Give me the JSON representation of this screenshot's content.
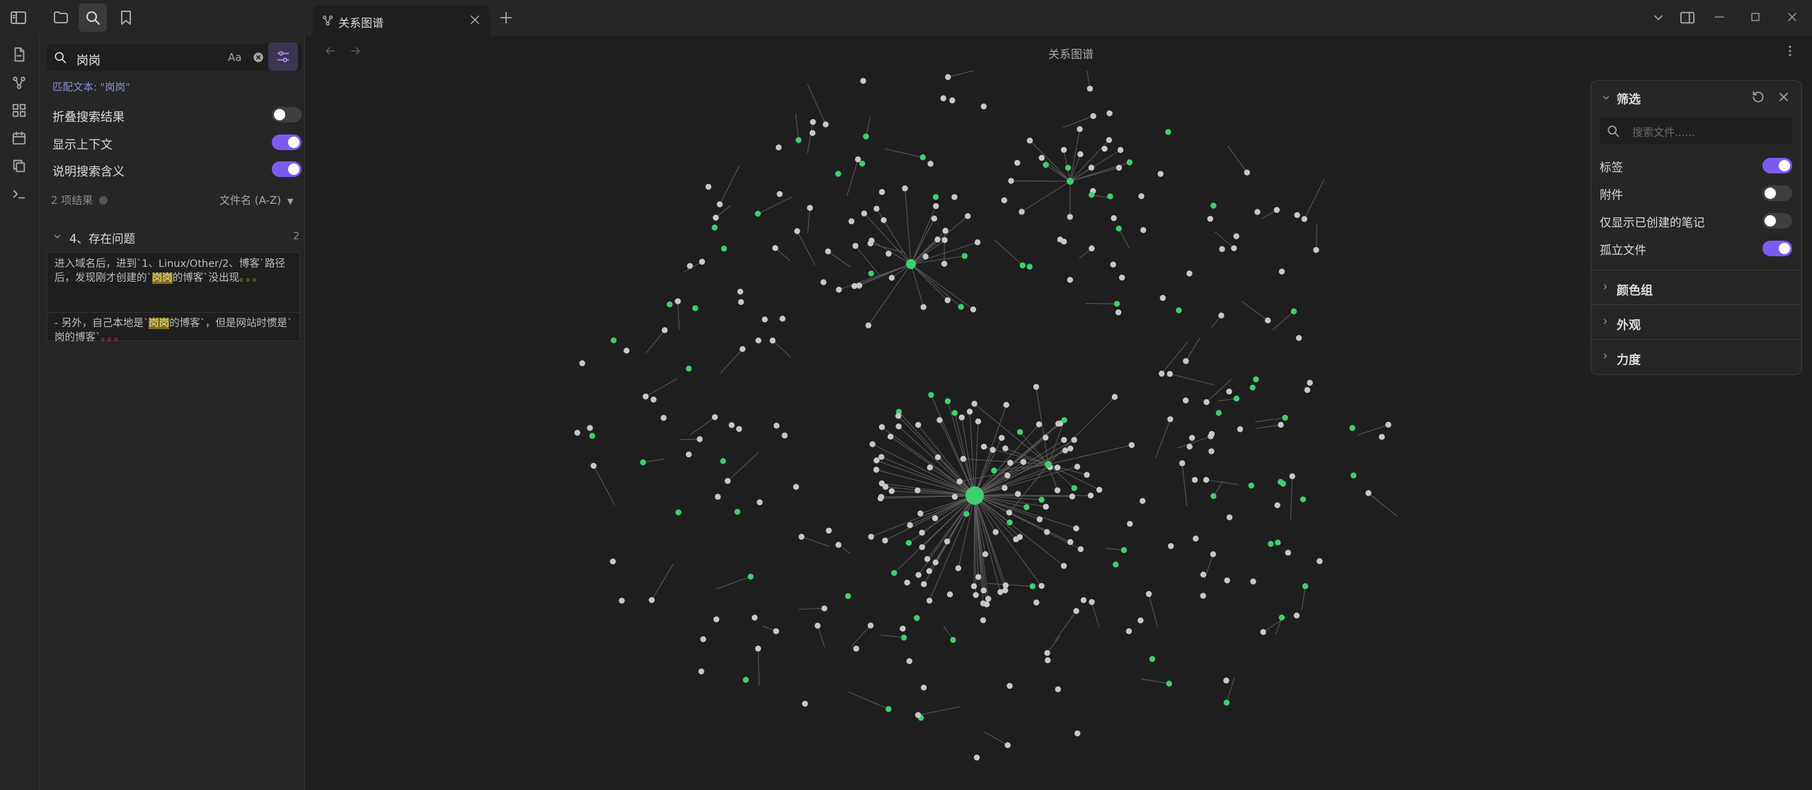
{
  "tab": {
    "title": "关系图谱"
  },
  "main": {
    "view_title": "关系图谱"
  },
  "search": {
    "query": "岗岗",
    "match_case_label": "Aa",
    "match_text": "匹配文本: \"岗岗\"",
    "options": [
      {
        "label": "折叠搜索结果",
        "on": false
      },
      {
        "label": "显示上下文",
        "on": true
      },
      {
        "label": "说明搜索含义",
        "on": true
      }
    ],
    "result_count": "2 项结果",
    "sort_label": "文件名 (A-Z)",
    "file": {
      "name": "4、存在问题",
      "count": "2"
    },
    "results": [
      {
        "before": "进入域名后，进到`1、Linux/Other/2、博客`路径后，发现刚才创建的`",
        "match": "岗岗",
        "after": "的博客`没出现",
        "ellipsis": "。。。"
      },
      {
        "before": "- 另外，自己本地是`",
        "match": "岗岗",
        "after": "的博客`，但是网站时惯是`岗的博客`",
        "ellipsis": "。。。"
      }
    ]
  },
  "filter_panel": {
    "title": "筛选",
    "search_placeholder": "搜索文件......",
    "toggles": [
      {
        "label": "标签",
        "on": true
      },
      {
        "label": "附件",
        "on": false
      },
      {
        "label": "仅显示已创建的笔记",
        "on": false
      },
      {
        "label": "孤立文件",
        "on": true
      }
    ],
    "sections": [
      "颜色组",
      "外观",
      "力度"
    ]
  },
  "colors": {
    "accent": "#7c5cf0",
    "node_default": "#c8c8c8",
    "node_tag": "#3fcf6e",
    "edge": "#5a5a5a",
    "highlight": "#807016"
  }
}
